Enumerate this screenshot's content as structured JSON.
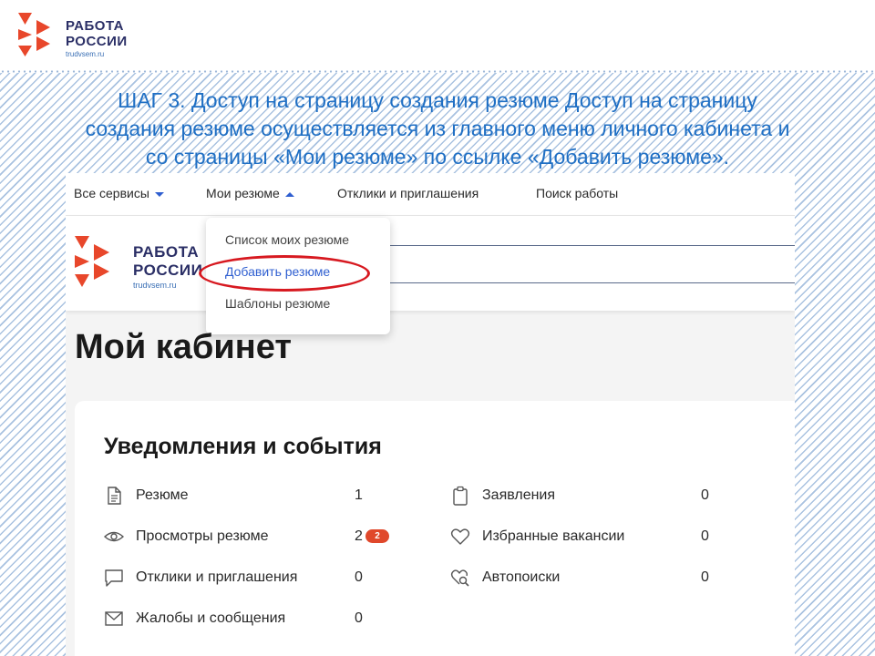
{
  "slide": {
    "logo_line1": "РАБОТА",
    "logo_line2": "РОССИИ",
    "logo_site": "trudvsem.ru",
    "heading_lines": [
      "ШАГ 3. Доступ на страницу создания резюме Доступ на страницу",
      "создания резюме осуществляется из главного меню личного кабинета и",
      "со страницы «Мои резюме» по ссылке «Добавить резюме»."
    ]
  },
  "nav": {
    "all_services": "Все сервисы",
    "my_resumes": "Мои резюме",
    "responses": "Отклики и приглашения",
    "job_search": "Поиск работы"
  },
  "site_logo": {
    "line1": "РАБОТА",
    "line2": "РОССИИ",
    "site": "trudvsem.ru"
  },
  "dropdown": {
    "items": [
      "Список моих резюме",
      "Добавить резюме",
      "Шаблоны резюме"
    ]
  },
  "page": {
    "title": "Мой кабинет"
  },
  "notifications": {
    "title": "Уведомления и события",
    "left": [
      {
        "label": "Резюме",
        "count": "1",
        "icon": "document-icon"
      },
      {
        "label": "Просмотры резюме",
        "count": "2",
        "badge": "2",
        "icon": "eye-icon"
      },
      {
        "label": "Отклики и приглашения",
        "count": "0",
        "icon": "chat-icon"
      },
      {
        "label": "Жалобы и сообщения",
        "count": "0",
        "icon": "envelope-icon"
      }
    ],
    "right": [
      {
        "label": "Заявления",
        "count": "0",
        "icon": "clipboard-icon"
      },
      {
        "label": "Избранные вакансии",
        "count": "0",
        "icon": "heart-icon"
      },
      {
        "label": "Автопоиски",
        "count": "0",
        "icon": "heart-search-icon"
      }
    ]
  },
  "colors": {
    "heading": "#1f6fc4",
    "accent_link": "#2f5fd0",
    "highlight_oval": "#d71920",
    "badge": "#e0482b",
    "logo_red": "#e8472b",
    "logo_text": "#2b2f66"
  }
}
